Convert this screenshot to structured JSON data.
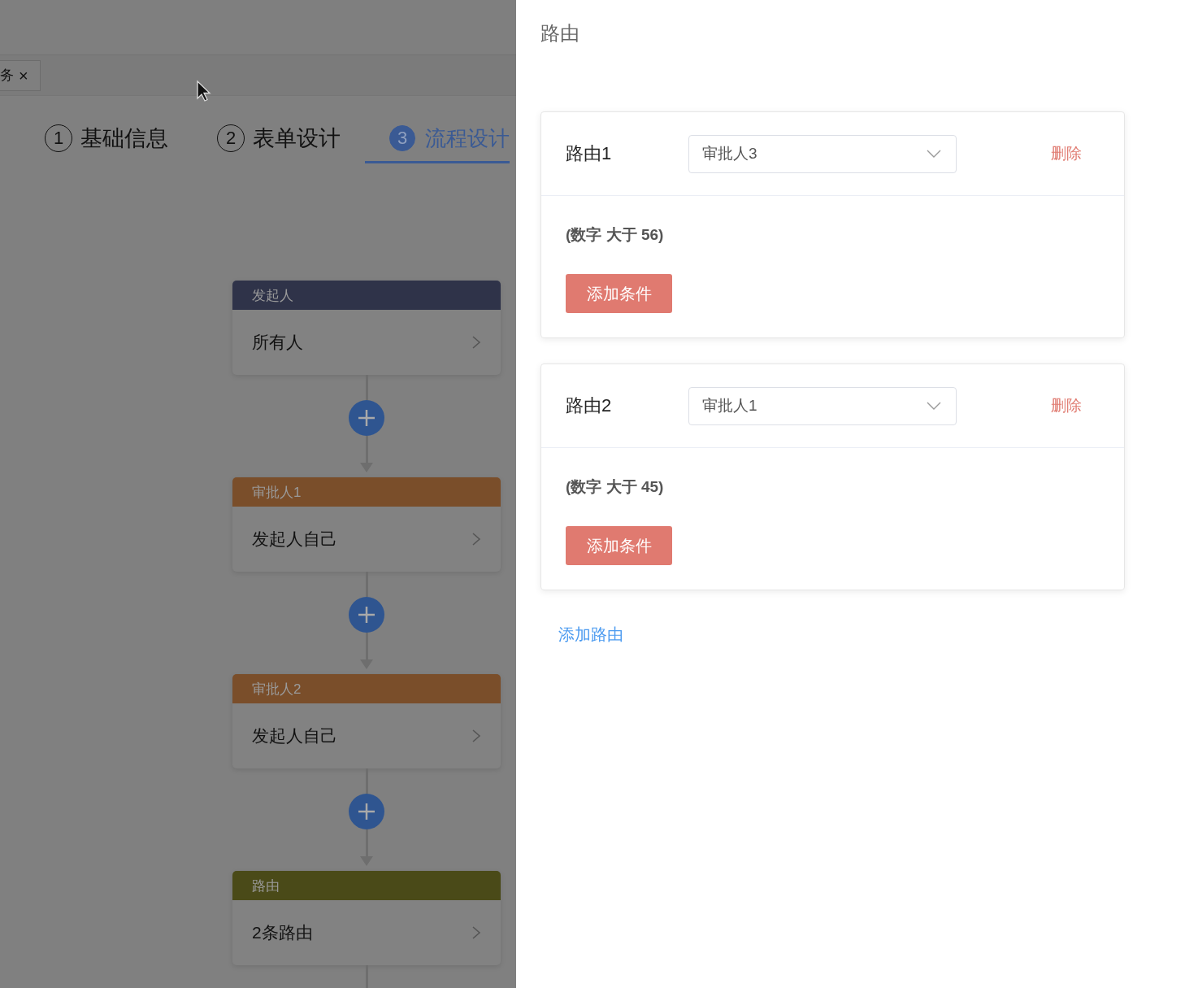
{
  "tab": {
    "label": "务",
    "close": "×"
  },
  "steps": [
    {
      "number": "1",
      "label": "基础信息",
      "selected": false
    },
    {
      "number": "2",
      "label": "表单设计",
      "selected": false
    },
    {
      "number": "3",
      "label": "流程设计",
      "selected": true
    }
  ],
  "nodes": [
    {
      "title": "发起人",
      "content": "所有人",
      "color": "#2f3349"
    },
    {
      "title": "审批人1",
      "content": "发起人自己",
      "color": "#7a4e2a"
    },
    {
      "title": "审批人2",
      "content": "发起人自己",
      "color": "#7a4e2a"
    },
    {
      "title": "路由",
      "content": "2条路由",
      "color": "#4a4a18"
    }
  ],
  "drawer": {
    "title": "路由",
    "routes": [
      {
        "name": "路由1",
        "approver": "审批人3",
        "delete": "删除",
        "condition": "(数字 大于 56)",
        "add_condition": "添加条件"
      },
      {
        "name": "路由2",
        "approver": "审批人1",
        "delete": "删除",
        "condition": "(数字 大于 45)",
        "add_condition": "添加条件"
      }
    ],
    "add_route": "添加路由"
  }
}
